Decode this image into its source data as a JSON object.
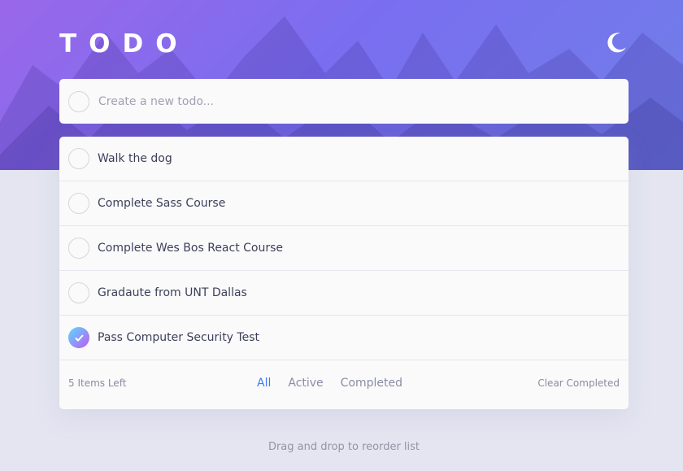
{
  "app": {
    "title": "TODO",
    "theme_icon": "moon-icon"
  },
  "new_todo": {
    "placeholder": "Create a new todo..."
  },
  "todos": [
    {
      "text": "Walk the dog",
      "completed": false
    },
    {
      "text": "Complete Sass Course",
      "completed": false
    },
    {
      "text": "Complete Wes Bos React Course",
      "completed": false
    },
    {
      "text": "Gradaute from UNT Dallas",
      "completed": false
    },
    {
      "text": "Pass Computer Security Test",
      "completed": true
    }
  ],
  "footer": {
    "items_left": "5 Items Left",
    "filters": [
      "All",
      "Active",
      "Completed"
    ],
    "active_filter": "All",
    "clear_label": "Clear Completed"
  },
  "hint": "Drag and drop to reorder list",
  "colors": {
    "accent": "#3a7bfd",
    "check_gradient_start": "#57ddff",
    "check_gradient_end": "#c058f3",
    "page_bg": "#e4e5f1"
  }
}
